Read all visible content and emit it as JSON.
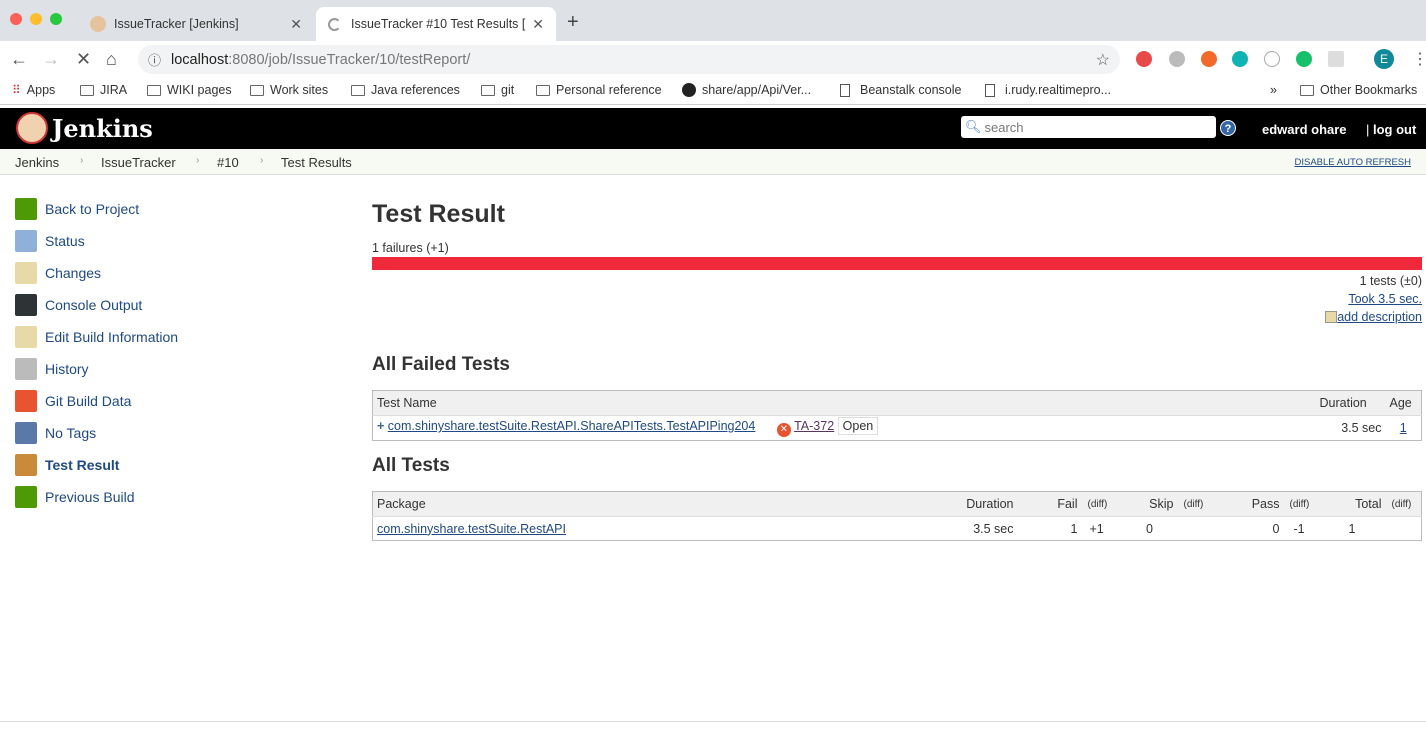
{
  "browser": {
    "tabs": [
      {
        "title": "IssueTracker [Jenkins]"
      },
      {
        "title": "IssueTracker #10 Test Results ["
      }
    ],
    "url_host": "localhost",
    "url_rest": ":8080/job/IssueTracker/10/testReport/",
    "bookmarks": [
      "Apps",
      "JIRA",
      "WIKI pages",
      "Work sites",
      "Java references",
      "git",
      "Personal reference",
      "share/app/Api/Ver...",
      "Beanstalk console",
      "i.rudy.realtimepro..."
    ],
    "other_bookmarks": "Other Bookmarks",
    "profile_initial": "E"
  },
  "header": {
    "logo": "Jenkins",
    "search_placeholder": "search",
    "help": "?",
    "user": "edward ohare",
    "logout": "log out"
  },
  "breadcrumbs": [
    "Jenkins",
    "IssueTracker",
    "#10",
    "Test Results"
  ],
  "disable_refresh": "DISABLE AUTO REFRESH",
  "sidebar": {
    "items": [
      {
        "label": "Back to Project",
        "icon": "up-arrow-icon",
        "color": "#4e9a06"
      },
      {
        "label": "Status",
        "icon": "magnifier-icon",
        "color": "#8fb0d8"
      },
      {
        "label": "Changes",
        "icon": "notepad-icon",
        "color": "#e8d9a8"
      },
      {
        "label": "Console Output",
        "icon": "terminal-icon",
        "color": "#2e3436"
      },
      {
        "label": "Edit Build Information",
        "icon": "notepad-icon",
        "color": "#e8d9a8"
      },
      {
        "label": "History",
        "icon": "history-icon",
        "color": "#bbbbbb"
      },
      {
        "label": "Git Build Data",
        "icon": "git-icon",
        "color": "#e8542f"
      },
      {
        "label": "No Tags",
        "icon": "save-icon",
        "color": "#5a78a8"
      },
      {
        "label": "Test Result",
        "icon": "clipboard-icon",
        "color": "#c98a3a"
      },
      {
        "label": "Previous Build",
        "icon": "left-arrow-icon",
        "color": "#4e9a06"
      }
    ]
  },
  "main": {
    "title": "Test Result",
    "failures": "1 failures (+1)",
    "fail_fraction": 1.0,
    "tests": "1 tests (±0)",
    "took": "Took 3.5 sec.",
    "add_description": "add description",
    "failed_title": "All Failed Tests",
    "failed_headers": [
      "Test Name",
      "Duration",
      "Age"
    ],
    "failed_rows": [
      {
        "name": "com.shinyshare.testSuite.RestAPI.ShareAPITests.TestAPIPing204",
        "issue": "TA-372",
        "issue_status": "Open",
        "duration": "3.5 sec",
        "age": "1"
      }
    ],
    "all_title": "All Tests",
    "all_headers": [
      "Package",
      "Duration",
      "Fail",
      "(diff)",
      "Skip",
      "(diff)",
      "Pass",
      "(diff)",
      "Total",
      "(diff)"
    ],
    "all_rows": [
      {
        "package": "com.shinyshare.testSuite.RestAPI",
        "duration": "3.5 sec",
        "fail": "1",
        "fail_diff": "+1",
        "skip": "0",
        "skip_diff": "",
        "pass": "0",
        "pass_diff": "-1",
        "total": "1",
        "total_diff": ""
      }
    ]
  }
}
